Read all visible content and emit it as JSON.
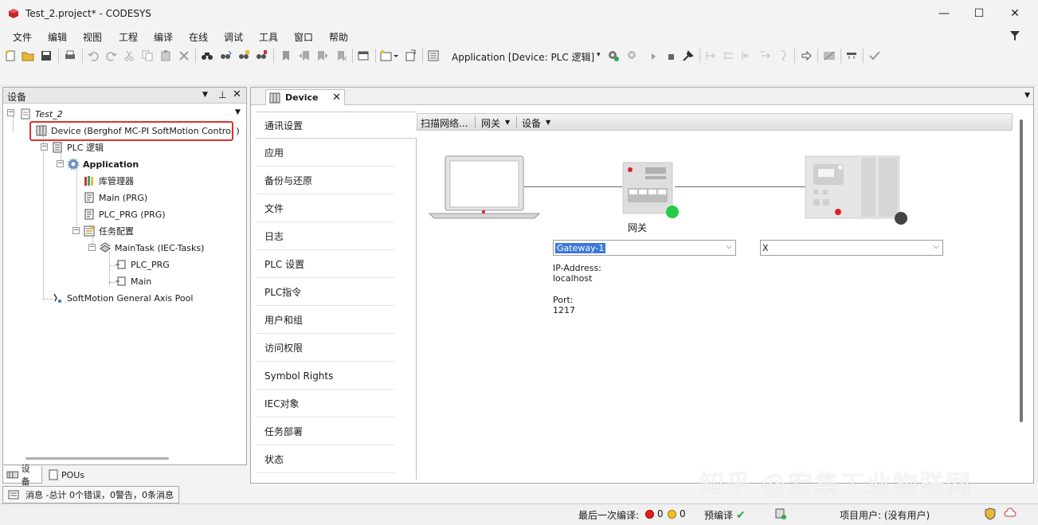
{
  "window": {
    "title": "Test_2.project* - CODESYS",
    "minimize": "—",
    "maximize": "☐",
    "close": "✕"
  },
  "menu": [
    "文件",
    "编辑",
    "视图",
    "工程",
    "编译",
    "在线",
    "调试",
    "工具",
    "窗口",
    "帮助"
  ],
  "toolbar": {
    "active_app": "Application [Device: PLC 逻辑]"
  },
  "device_panel": {
    "title": "设备",
    "tree": [
      {
        "label": "Test_2",
        "icon": "project-icon"
      },
      {
        "label": "Device (Berghof MC-PI SoftMotion Control )",
        "icon": "device-icon"
      },
      {
        "label": "PLC 逻辑",
        "icon": "plc-logic-icon"
      },
      {
        "label": "Application",
        "icon": "application-gear-icon"
      },
      {
        "label": "库管理器",
        "icon": "library-manager-icon"
      },
      {
        "label": "Main (PRG)",
        "icon": "pou-icon"
      },
      {
        "label": "PLC_PRG (PRG)",
        "icon": "pou-icon"
      },
      {
        "label": "任务配置",
        "icon": "task-config-icon"
      },
      {
        "label": "MainTask (IEC-Tasks)",
        "icon": "task-icon"
      },
      {
        "label": "PLC_PRG",
        "icon": "program-call-icon"
      },
      {
        "label": "Main",
        "icon": "program-call-icon"
      },
      {
        "label": "SoftMotion General Axis Pool",
        "icon": "axis-pool-icon"
      }
    ]
  },
  "bottom_tabs": [
    "设备",
    "POUs"
  ],
  "messages": "消息 -总计 0个错误，0警告，0条消息",
  "editor": {
    "tab_label": "Device",
    "tab_close": "✕",
    "nav": [
      "通讯设置",
      "应用",
      "备份与还原",
      "文件",
      "日志",
      "PLC 设置",
      "PLC指令",
      "用户和组",
      "访问权限",
      "Symbol Rights",
      "IEC对象",
      "任务部署",
      "状态"
    ],
    "comm_toolbar": {
      "scan": "扫描网络...",
      "gateway": "网关",
      "device": "设备"
    },
    "gateway_label": "网关",
    "gateway_select": "Gateway-1",
    "device_select": "X",
    "ip_label": "IP-Address:",
    "ip_value": "localhost",
    "port_label": "Port:",
    "port_value": "1217"
  },
  "status": {
    "last_compile": "最后一次编译:",
    "errors": "0",
    "warnings": "0",
    "precompile": "预编译",
    "project_user": "项目用户: (没有用户)"
  },
  "watermark": "知乎 @宏集工业物联网",
  "colors": {
    "selection_box": "#e03030",
    "status_green": "#22cc44",
    "status_dark": "#444444",
    "select_highlight": "#3a78d6"
  }
}
